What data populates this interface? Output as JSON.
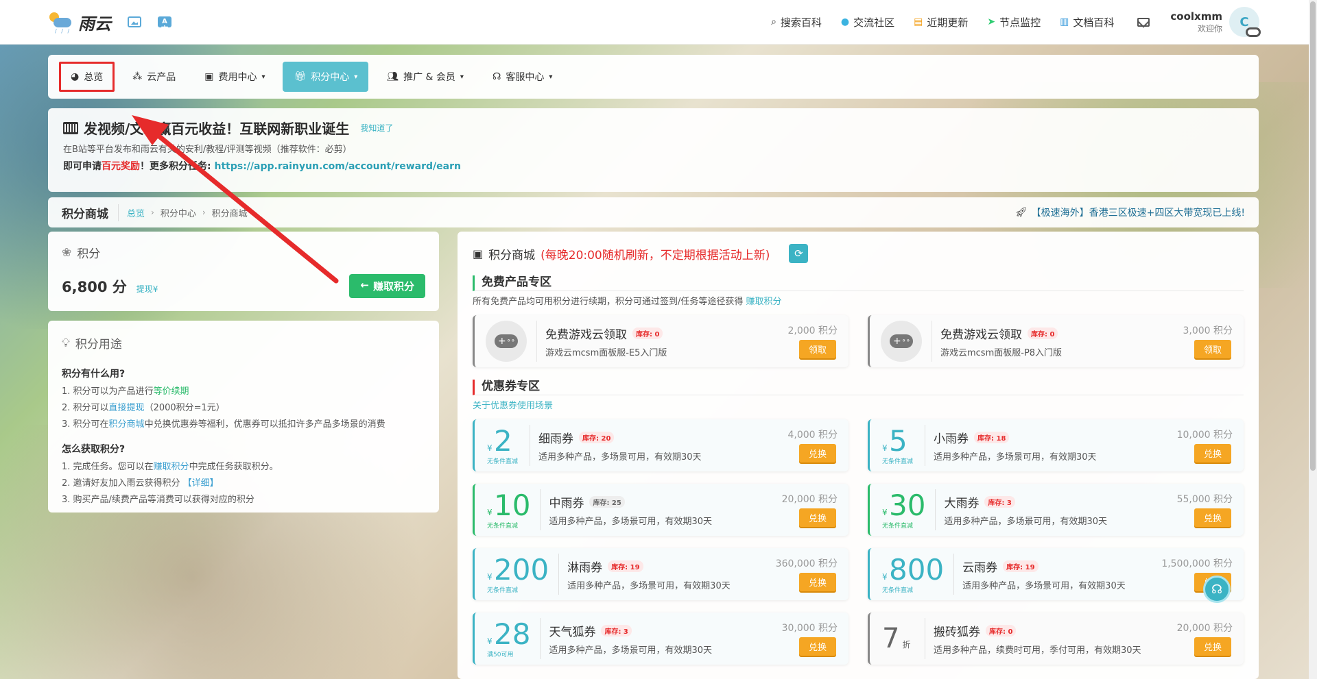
{
  "header": {
    "logo_text": "雨云",
    "translate_glyph": "A文",
    "nav": [
      {
        "label": "搜索百科",
        "icon": "search-icon"
      },
      {
        "label": "交流社区",
        "icon": "community-icon"
      },
      {
        "label": "近期更新",
        "icon": "updates-icon"
      },
      {
        "label": "节点监控",
        "icon": "node-monitor-icon"
      },
      {
        "label": "文档百科",
        "icon": "docs-icon"
      }
    ],
    "user": {
      "name": "coolxmm",
      "greeting": "欢迎你",
      "avatar_letter": "C"
    }
  },
  "subnav": {
    "tabs": [
      {
        "label": "总览",
        "highlighted": true
      },
      {
        "label": "云产品"
      },
      {
        "label": "费用中心",
        "has_caret": true
      },
      {
        "label": "积分中心",
        "has_caret": true,
        "active": true
      },
      {
        "label": "推广 & 会员",
        "has_caret": true
      },
      {
        "label": "客服中心",
        "has_caret": true
      }
    ]
  },
  "announcement": {
    "title": "发视频/文章赢百元收益！互联网新职业诞生",
    "dismiss": "我知道了",
    "line2": "在B站等平台发布和雨云有关的安利/教程/评测等视频（推荐软件：必剪）",
    "line3_prefix": "即可申请",
    "line3_red": "百元奖励",
    "line3_mid": "！更多积分任务: ",
    "line3_link": "https://app.rainyun.com/account/reward/earn"
  },
  "breadcrumb": {
    "title": "积分商城",
    "items": [
      "总览",
      "积分中心",
      "积分商城"
    ],
    "sep": "›",
    "notice": "【极速海外】香港三区极速+四区大带宽现已上线!"
  },
  "points": {
    "heading": "积分",
    "value": "6,800 分",
    "withdraw": "提现¥",
    "earn_button": "赚取积分"
  },
  "usage": {
    "heading": "积分用途",
    "q1": "积分有什么用?",
    "l1a": "1. 积分可以为产品进行",
    "l1b": "等价续期",
    "l2a": "2. 积分可以",
    "l2b": "直接提现",
    "l2c": "（2000积分=1元）",
    "l3a": "3. 积分可在",
    "l3b": "积分商城",
    "l3c": "中兑换优惠券等福利，优惠券可以抵扣许多产品多场景的消费",
    "q2": "怎么获取积分?",
    "m1a": "1. 完成任务。您可以在",
    "m1b": "赚取积分",
    "m1c": "中完成任务获取积分。",
    "m2a": "2. 邀请好友加入雨云获得积分 ",
    "m2b": "【详细】",
    "m3": "3. 购买产品/续费产品等消费可以获得对应的积分"
  },
  "mall": {
    "name": "积分商城",
    "note": "(每晚20:00随机刷新，不定期根据活动上新)",
    "free_section": {
      "title": "免费产品专区",
      "desc": "所有免费产品均可用积分进行续期，积分可通过签到/任务等途径获得 ",
      "desc_link": "赚取积分",
      "items": [
        {
          "name": "免费游戏云领取",
          "stock": "库存: 0",
          "desc": "游戏云mcsm面板服-E5入门版",
          "price": "2,000 积分",
          "button": "领取"
        },
        {
          "name": "免费游戏云领取",
          "stock": "库存: 0",
          "desc": "游戏云mcsm面板服-P8入门版",
          "price": "3,000 积分",
          "button": "领取"
        }
      ]
    },
    "coupon_section": {
      "title": "优惠券专区",
      "link": "关于优惠券使用场景",
      "items": [
        {
          "amount": "2",
          "cond": "无条件直减",
          "name": "细雨券",
          "stock": "库存: 20",
          "desc": "适用多种产品，多场景可用，有效期30天",
          "price": "4,000 积分",
          "button": "兑换",
          "style": "cyan"
        },
        {
          "amount": "5",
          "cond": "无条件直减",
          "name": "小雨券",
          "stock": "库存: 18",
          "desc": "适用多种产品，多场景可用，有效期30天",
          "price": "10,000 积分",
          "button": "兑换",
          "style": "cyan"
        },
        {
          "amount": "10",
          "cond": "无条件直减",
          "name": "中雨券",
          "stock": "库存: 25",
          "desc": "适用多种产品，多场景可用，有效期30天",
          "price": "20,000 积分",
          "button": "兑换",
          "style": "green",
          "stock_grey": true
        },
        {
          "amount": "30",
          "cond": "无条件直减",
          "name": "大雨券",
          "stock": "库存: 3",
          "desc": "适用多种产品，多场景可用，有效期30天",
          "price": "55,000 积分",
          "button": "兑换",
          "style": "green"
        },
        {
          "amount": "200",
          "cond": "无条件直减",
          "name": "淋雨券",
          "stock": "库存: 19",
          "desc": "适用多种产品，多场景可用，有效期30天",
          "price": "360,000 积分",
          "button": "兑换",
          "style": "cyan"
        },
        {
          "amount": "800",
          "cond": "无条件直减",
          "name": "云雨券",
          "stock": "库存: 19",
          "desc": "适用多种产品，多场景可用，有效期30天",
          "price": "1,500,000 积分",
          "button": "兑换",
          "style": "cyan"
        },
        {
          "amount": "28",
          "cond": "满50可用",
          "name": "天气狐券",
          "stock": "库存: 3",
          "desc": "适用多种产品，多场景可用，有效期30天",
          "price": "30,000 积分",
          "button": "兑换",
          "style": "cyan"
        },
        {
          "amount": "7",
          "cond": "折",
          "name": "搬砖狐券",
          "stock": "库存: 0",
          "desc": "适用多种产品，续费时可用，季付可用，有效期30天",
          "price": "20,000 积分",
          "button": "兑换",
          "style": "grey"
        }
      ]
    }
  },
  "colors": {
    "accent": "#3bb3c4",
    "green": "#2bbb6b",
    "red": "#e62b2b",
    "orange": "#f5a623"
  }
}
